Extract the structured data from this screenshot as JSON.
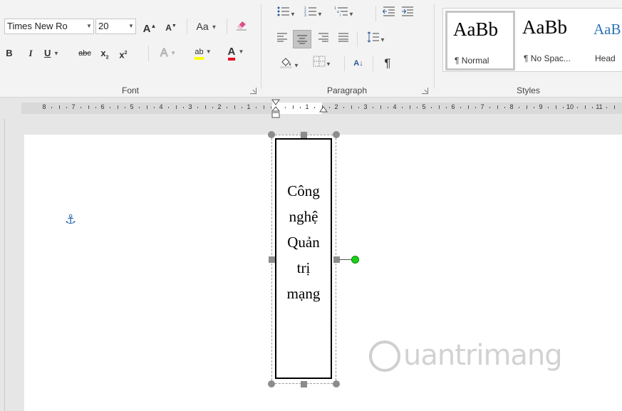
{
  "font": {
    "name": "Times New Ro",
    "size": "20",
    "grow_label": "A",
    "shrink_label": "A",
    "change_case_label": "Aa",
    "bold": "B",
    "italic": "I",
    "underline": "U",
    "strike": "abc",
    "subscript": "x",
    "superscript": "x",
    "text_effects": "A",
    "highlight": "ab",
    "font_color": "A",
    "group_label": "Font"
  },
  "paragraph": {
    "group_label": "Paragraph",
    "sort_label": "A↓",
    "pilcrow": "¶"
  },
  "styles": {
    "group_label": "Styles",
    "items": [
      {
        "preview": "AaBb",
        "name": "¶ Normal"
      },
      {
        "preview": "AaBb",
        "name": "¶ No Spac..."
      },
      {
        "preview": "AaB",
        "name": "Head"
      }
    ]
  },
  "ruler": {
    "labels": [
      "8",
      "7",
      "6",
      "5",
      "4",
      "3",
      "2",
      "1",
      "1",
      "2",
      "3",
      "4",
      "5",
      "6",
      "7",
      "8",
      "9",
      "10",
      "11"
    ]
  },
  "textbox": {
    "lines": [
      "Công",
      "nghệ",
      "Quản",
      "trị",
      "mạng"
    ]
  },
  "watermark": {
    "text": "uantrimang"
  },
  "colors": {
    "highlight": "#ffff00",
    "font_color": "#e81123",
    "anchor": "#2f6fb1",
    "rotate_handle": "#19d219"
  }
}
